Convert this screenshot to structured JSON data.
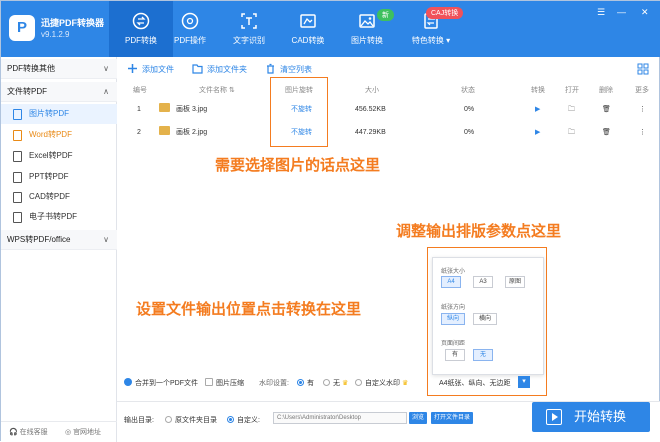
{
  "app": {
    "name": "迅捷PDF转换器",
    "version": "v9.1.2.9"
  },
  "window_controls": [
    "☰",
    "—",
    "✕"
  ],
  "tabs": [
    {
      "label": "PDF转换",
      "icon": "convert-icon"
    },
    {
      "label": "PDF操作",
      "icon": "pdf-ops-icon"
    },
    {
      "label": "文字识别",
      "icon": "ocr-icon"
    },
    {
      "label": "CAD转换",
      "icon": "cad-icon"
    },
    {
      "label": "图片转换",
      "icon": "image-icon",
      "badge": "新"
    },
    {
      "label": "特色转换 ▾",
      "icon": "special-icon",
      "badge": "CAJ转换"
    }
  ],
  "sidebar": {
    "section1": "PDF转换其他",
    "section2": "文件转PDF",
    "items": [
      "图片转PDF",
      "Word转PDF",
      "Excel转PDF",
      "PPT转PDF",
      "CAD转PDF",
      "电子书转PDF"
    ],
    "section3": "WPS转PDF/office",
    "bottom": {
      "service": "在线客服",
      "website": "官网地址"
    }
  },
  "toolbar": {
    "add_file": "添加文件",
    "add_folder": "添加文件夹",
    "clear_list": "清空列表"
  },
  "table": {
    "headers": {
      "num": "编号",
      "name": "文件名称 ⇅",
      "rotate": "图片旋转",
      "size": "大小",
      "status": "状态",
      "convert": "转换",
      "open": "打开",
      "delete": "删除",
      "more": "更多"
    },
    "rows": [
      {
        "num": "1",
        "name": "画板 3.jpg",
        "rotate": "不旋转",
        "size": "456.52KB",
        "status": "0%"
      },
      {
        "num": "2",
        "name": "画板 2.jpg",
        "rotate": "不旋转",
        "size": "447.29KB",
        "status": "0%"
      }
    ]
  },
  "annotations": {
    "rotate_hint": "需要选择图片的话点这里",
    "layout_hint": "调整输出排版参数点这里",
    "output_hint": "设置文件输出位置点击转换在这里"
  },
  "panel": {
    "paper_size_label": "纸张大小",
    "paper_sizes": [
      "A4",
      "A3",
      "原图"
    ],
    "orientation_label": "纸张方向",
    "orientations": [
      "纵向",
      "横向"
    ],
    "margin_label": "页面间距",
    "margins": [
      "有",
      "无"
    ]
  },
  "options": {
    "merge": "合并到一个PDF文件",
    "compress": "图片压缩",
    "watermark_label": "水印设置:",
    "wm_yes": "有",
    "wm_no": "无",
    "wm_custom": "自定义水印",
    "layout_summary": "A4纸张、纵向、无边距"
  },
  "output": {
    "label": "输出目录:",
    "orig_dir": "原文件夹目录",
    "custom": "自定义:",
    "path": "C:\\Users\\Administrator\\Desktop",
    "browse": "浏览",
    "open_dir": "打开文件目录"
  },
  "start_button": "开始转换",
  "colors": {
    "primary": "#2e86e6",
    "annotation": "#f47c20"
  }
}
